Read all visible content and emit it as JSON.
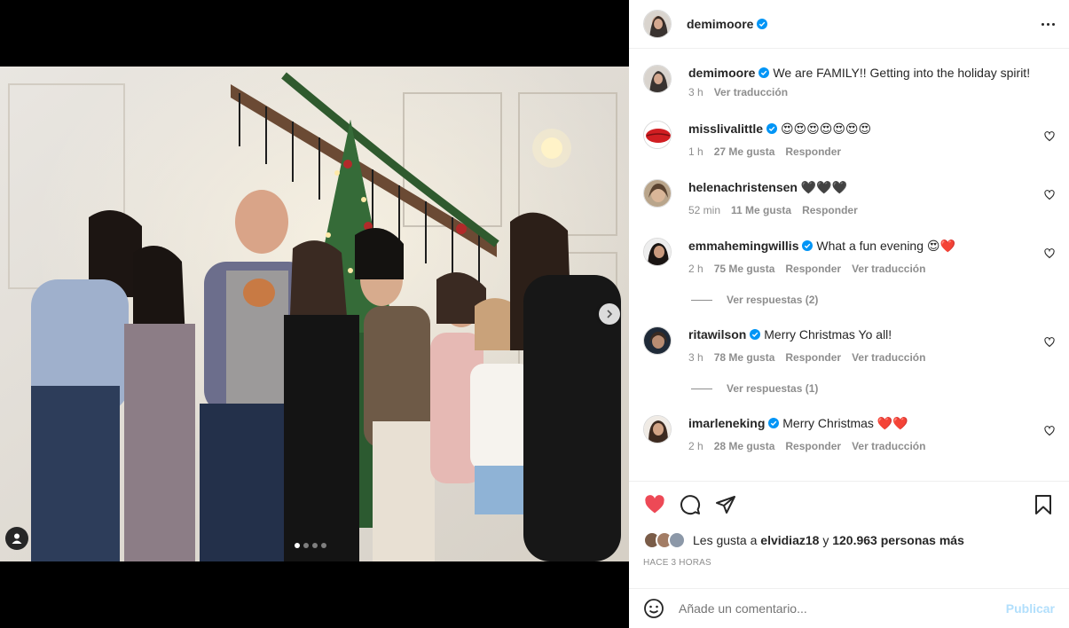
{
  "post": {
    "author": "demimoore",
    "caption": "We are FAMILY!! Getting into the holiday spirit!",
    "caption_time": "3 h",
    "caption_translate": "Ver traducción"
  },
  "comments": [
    {
      "user": "misslivalittle",
      "verified": true,
      "text": "😍😍😍😍😍😍😍",
      "time": "1 h",
      "likes": "27 Me gusta",
      "reply": "Responder",
      "translate": ""
    },
    {
      "user": "helenachristensen",
      "verified": false,
      "text": "🖤🖤🖤",
      "time": "52 min",
      "likes": "11 Me gusta",
      "reply": "Responder",
      "translate": ""
    },
    {
      "user": "emmahemingwillis",
      "verified": true,
      "text": "What a fun evening 😍❤️",
      "time": "2 h",
      "likes": "75 Me gusta",
      "reply": "Responder",
      "translate": "Ver traducción",
      "replies": "Ver respuestas (2)"
    },
    {
      "user": "ritawilson",
      "verified": true,
      "text": "Merry Christmas Yo all!",
      "time": "3 h",
      "likes": "78 Me gusta",
      "reply": "Responder",
      "translate": "Ver traducción",
      "replies": "Ver respuestas (1)"
    },
    {
      "user": "imarleneking",
      "verified": true,
      "text": "Merry Christmas ❤️❤️",
      "time": "2 h",
      "likes": "28 Me gusta",
      "reply": "Responder",
      "translate": "Ver traducción"
    }
  ],
  "likes": {
    "prefix": "Les gusta a",
    "first_user": "elvidiaz18",
    "joiner": "y",
    "others": "120.963 personas más"
  },
  "posted_ago": "HACE 3 HORAS",
  "add_comment": {
    "placeholder": "Añade un comentario...",
    "publish": "Publicar"
  },
  "colors": {
    "verified": "#0095f6",
    "like_red": "#ed4956",
    "publish_disabled": "#b2dffc"
  },
  "carousel": {
    "count": 4,
    "active": 0
  }
}
